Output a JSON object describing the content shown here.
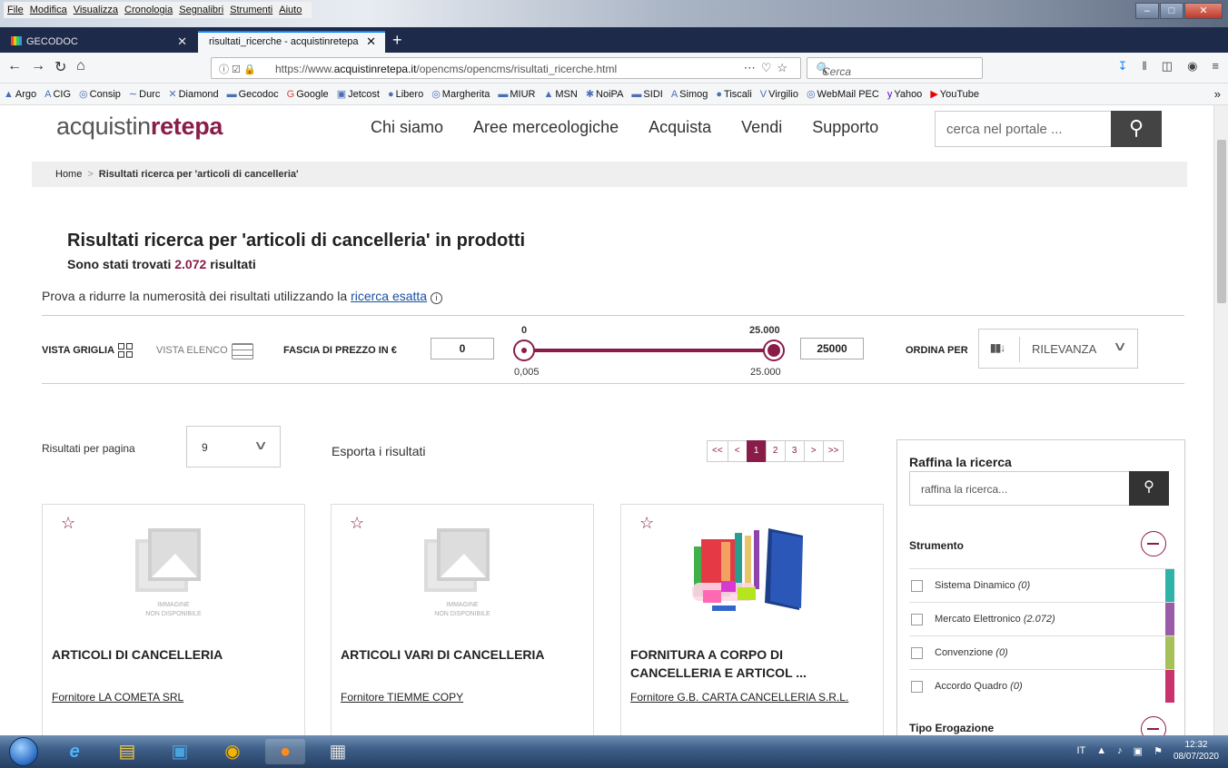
{
  "browser": {
    "menu": [
      "File",
      "Modifica",
      "Visualizza",
      "Cronologia",
      "Segnalibri",
      "Strumenti",
      "Aiuto"
    ],
    "tabs": [
      {
        "label": "GECODOC",
        "active": false
      },
      {
        "label": "risultati_ricerche - acquistinretepa",
        "active": true
      }
    ],
    "url_prefix": "https://www.",
    "url_domain": "acquistinretepa.it",
    "url_path": "/opencms/opencms/risultati_ricerche.html",
    "search_placeholder": "Cerca",
    "bookmarks": [
      "Argo",
      "CIG",
      "Consip",
      "Durc",
      "Diamond",
      "Gecodoc",
      "Google",
      "Jetcost",
      "Libero",
      "Margherita",
      "MIUR",
      "MSN",
      "NoiPA",
      "SIDI",
      "Simog",
      "Tiscali",
      "Virgilio",
      "WebMail PEC",
      "Yahoo",
      "YouTube"
    ]
  },
  "site": {
    "logo_a": "acquistin",
    "logo_b": "rete",
    "logo_c": "pa",
    "nav": [
      "Chi siamo",
      "Aree merceologiche",
      "Acquista",
      "Vendi",
      "Supporto"
    ],
    "search_placeholder": "cerca nel portale ..."
  },
  "breadcrumb": {
    "home": "Home",
    "current": "Risultati ricerca per 'articoli di cancelleria'"
  },
  "results": {
    "title": "Risultati ricerca per 'articoli di cancelleria' in prodotti",
    "count_prefix": "Sono stati trovati",
    "count": "2.072",
    "count_suffix": "risultati",
    "hint_prefix": "Prova a ridurre la numerosità dei risultati utilizzando la",
    "hint_link": "ricerca esatta"
  },
  "toolbar": {
    "view_grid": "VISTA GRIGLIA",
    "view_list": "VISTA ELENCO",
    "price_label": "FASCIA DI PREZZO IN €",
    "price_min": "0",
    "price_max": "25000",
    "slider_top_min": "0",
    "slider_top_max": "25.000",
    "slider_bottom_min": "0,005",
    "slider_bottom_max": "25.000",
    "sort_label": "ORDINA PER",
    "sort_value": "RILEVANZA"
  },
  "paging": {
    "per_page_label": "Risultati per pagina",
    "per_page": "9",
    "export": "Esporta i risultati",
    "pages": [
      "<<",
      "<",
      "1",
      "2",
      "3",
      ">",
      ">>"
    ],
    "current": "1"
  },
  "products": [
    {
      "title": "ARTICOLI DI CANCELLERIA",
      "vendor": "Fornitore LA COMETA SRL",
      "image_text": "IMMAGINE\nNON DISPONIBILE"
    },
    {
      "title": "ARTICOLI VARI DI CANCELLERIA",
      "vendor": "Fornitore TIEMME COPY",
      "image_text": "IMMAGINE\nNON DISPONIBILE"
    },
    {
      "title": "FORNITURA A CORPO DI CANCELLERIA E ARTICOL ...",
      "vendor": "Fornitore G.B. CARTA CANCELLERIA S.R.L."
    }
  ],
  "refine": {
    "title": "Raffina la ricerca",
    "placeholder": "raffina la ricerca...",
    "facet1": "Strumento",
    "options": [
      {
        "label": "Sistema Dinamico",
        "count": "(0)",
        "color": "#2fb3a8"
      },
      {
        "label": "Mercato Elettronico",
        "count": "(2.072)",
        "color": "#9a5ba8"
      },
      {
        "label": "Convenzione",
        "count": "(0)",
        "color": "#a6c05a"
      },
      {
        "label": "Accordo Quadro",
        "count": "(0)",
        "color": "#c8336e"
      }
    ],
    "facet2": "Tipo Erogazione"
  },
  "taskbar": {
    "lang": "IT",
    "time": "12:32",
    "date": "08/07/2020"
  },
  "colors": {
    "brand": "#8a1c4a"
  }
}
